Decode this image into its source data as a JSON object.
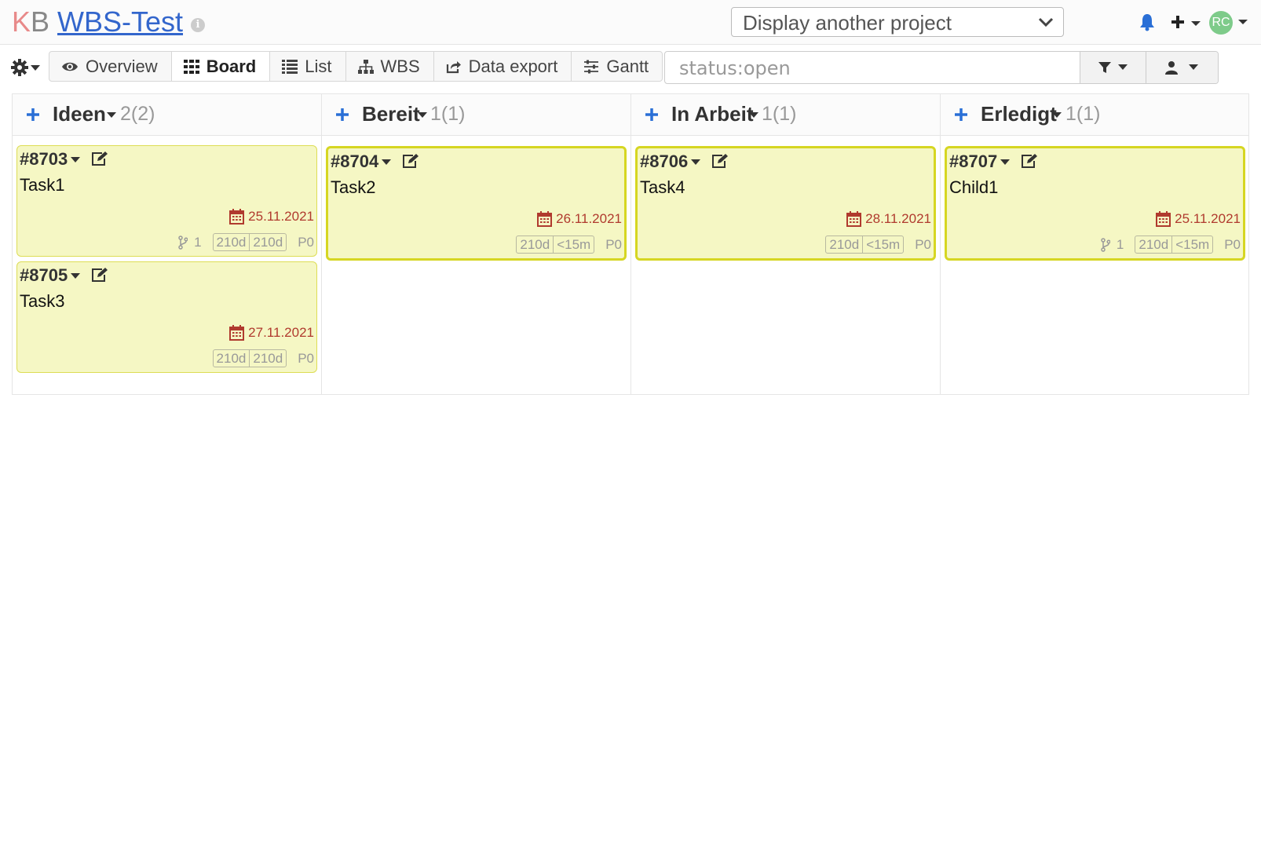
{
  "header": {
    "logo_k": "K",
    "logo_b": "B",
    "project_title": "WBS-Test",
    "info_icon": "i",
    "project_select_label": "Display another project",
    "avatar_initials": "RC"
  },
  "toolbar": {
    "views": [
      {
        "label": "Overview",
        "icon": "eye-icon",
        "active": false
      },
      {
        "label": "Board",
        "icon": "grid-icon",
        "active": true
      },
      {
        "label": "List",
        "icon": "list-icon",
        "active": false
      },
      {
        "label": "WBS",
        "icon": "sitemap-icon",
        "active": false
      },
      {
        "label": "Data export",
        "icon": "share-icon",
        "active": false
      },
      {
        "label": "Gantt",
        "icon": "sliders-icon",
        "active": false
      }
    ],
    "filter_placeholder": "status:open"
  },
  "columns": [
    {
      "name": "Ideen",
      "count": "2(2)",
      "cards": [
        {
          "id": "#8703",
          "title": "Task1",
          "date": "25.11.2021",
          "subtasks": "1",
          "time_estimated": "210d",
          "time_spent": "210d",
          "priority": "P0"
        },
        {
          "id": "#8705",
          "title": "Task3",
          "date": "27.11.2021",
          "subtasks": "",
          "time_estimated": "210d",
          "time_spent": "210d",
          "priority": "P0"
        }
      ]
    },
    {
      "name": "Bereit",
      "count": "1(1)",
      "cards": [
        {
          "id": "#8704",
          "title": "Task2",
          "date": "26.11.2021",
          "subtasks": "",
          "time_estimated": "210d",
          "time_spent": "<15m",
          "priority": "P0"
        }
      ]
    },
    {
      "name": "In Arbeit",
      "count": "1(1)",
      "cards": [
        {
          "id": "#8706",
          "title": "Task4",
          "date": "28.11.2021",
          "subtasks": "",
          "time_estimated": "210d",
          "time_spent": "<15m",
          "priority": "P0"
        }
      ]
    },
    {
      "name": "Erledigt",
      "count": "1(1)",
      "cards": [
        {
          "id": "#8707",
          "title": "Child1",
          "date": "25.11.2021",
          "subtasks": "1",
          "time_estimated": "210d",
          "time_spent": "<15m",
          "priority": "P0"
        }
      ]
    }
  ],
  "colors": {
    "link_blue": "#3366cc",
    "card_bg": "#f5f7c4",
    "card_border": "#d6d622",
    "date_red": "#b03a2e",
    "bell_blue": "#2a6fd6",
    "avatar_green": "#7ecb8a"
  }
}
